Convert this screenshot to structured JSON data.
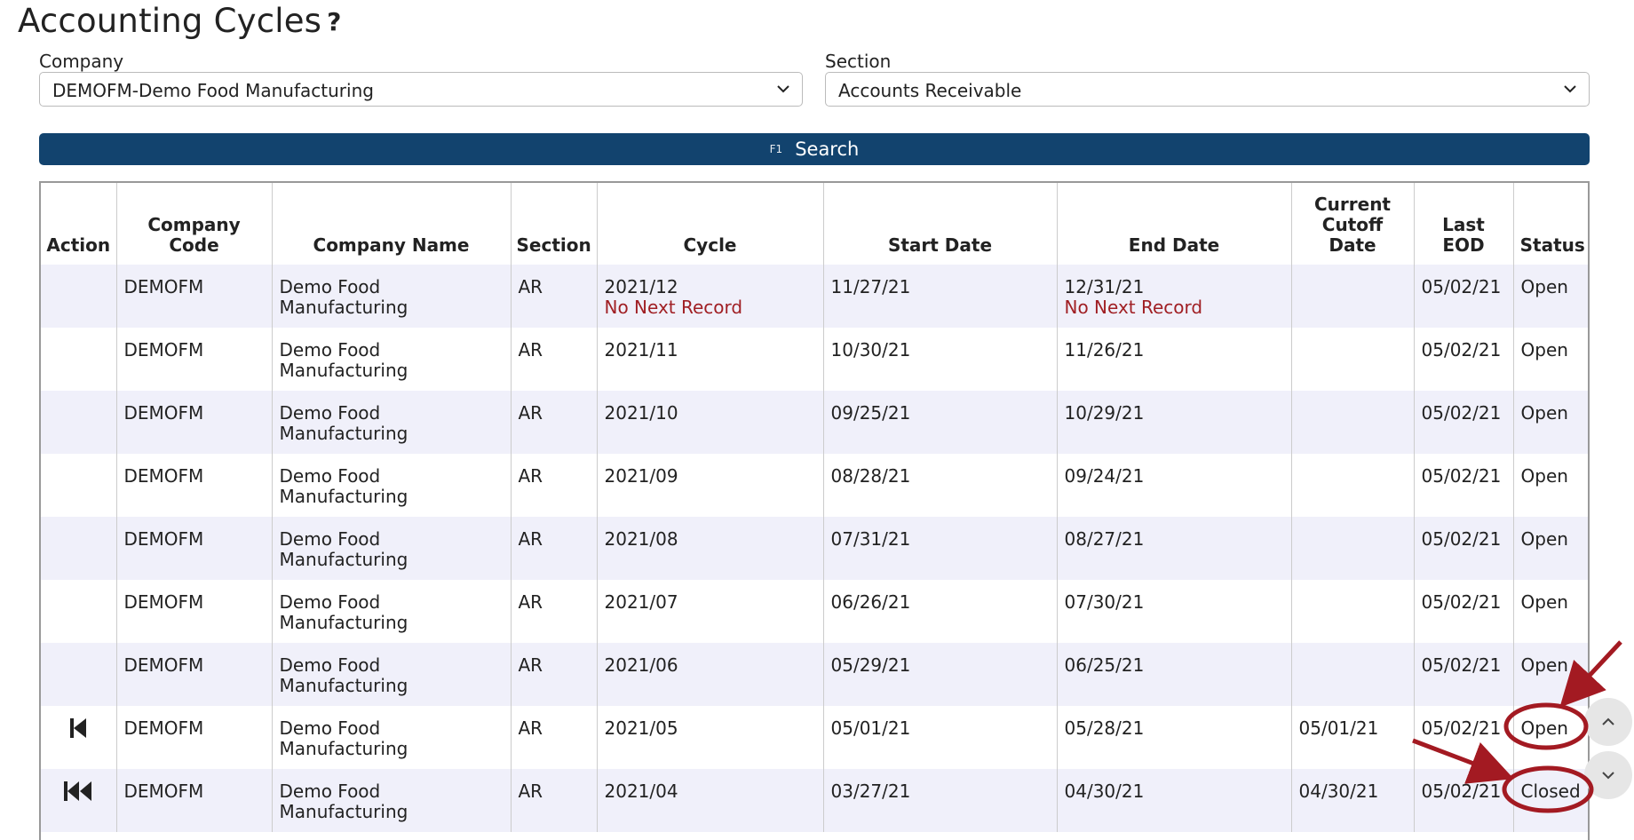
{
  "page": {
    "title": "Accounting Cycles",
    "help_glyph": "?"
  },
  "filters": {
    "company_label": "Company",
    "company_value": "DEMOFM-Demo Food Manufacturing",
    "section_label": "Section",
    "section_value": "Accounts Receivable"
  },
  "search": {
    "key_hint": "F1",
    "label": "Search"
  },
  "table": {
    "headers": [
      "Action",
      "Company Code",
      "Company Name",
      "Section",
      "Cycle",
      "Start Date",
      "End Date",
      "Current Cutoff Date",
      "Last EOD",
      "Status"
    ],
    "rows": [
      {
        "action_icon": "",
        "code": "DEMOFM",
        "name_1": "Demo Food",
        "name_2": "Manufacturing",
        "section": "AR",
        "cycle": "2021/12",
        "cycle_note": "No Next Record",
        "start": "11/27/21",
        "end": "12/31/21",
        "end_note": "No Next Record",
        "cutoff": "",
        "last_eod": "05/02/21",
        "status": "Open"
      },
      {
        "action_icon": "",
        "code": "DEMOFM",
        "name_1": "Demo Food",
        "name_2": "Manufacturing",
        "section": "AR",
        "cycle": "2021/11",
        "cycle_note": "",
        "start": "10/30/21",
        "end": "11/26/21",
        "end_note": "",
        "cutoff": "",
        "last_eod": "05/02/21",
        "status": "Open"
      },
      {
        "action_icon": "",
        "code": "DEMOFM",
        "name_1": "Demo Food",
        "name_2": "Manufacturing",
        "section": "AR",
        "cycle": "2021/10",
        "cycle_note": "",
        "start": "09/25/21",
        "end": "10/29/21",
        "end_note": "",
        "cutoff": "",
        "last_eod": "05/02/21",
        "status": "Open"
      },
      {
        "action_icon": "",
        "code": "DEMOFM",
        "name_1": "Demo Food",
        "name_2": "Manufacturing",
        "section": "AR",
        "cycle": "2021/09",
        "cycle_note": "",
        "start": "08/28/21",
        "end": "09/24/21",
        "end_note": "",
        "cutoff": "",
        "last_eod": "05/02/21",
        "status": "Open"
      },
      {
        "action_icon": "",
        "code": "DEMOFM",
        "name_1": "Demo Food",
        "name_2": "Manufacturing",
        "section": "AR",
        "cycle": "2021/08",
        "cycle_note": "",
        "start": "07/31/21",
        "end": "08/27/21",
        "end_note": "",
        "cutoff": "",
        "last_eod": "05/02/21",
        "status": "Open"
      },
      {
        "action_icon": "",
        "code": "DEMOFM",
        "name_1": "Demo Food",
        "name_2": "Manufacturing",
        "section": "AR",
        "cycle": "2021/07",
        "cycle_note": "",
        "start": "06/26/21",
        "end": "07/30/21",
        "end_note": "",
        "cutoff": "",
        "last_eod": "05/02/21",
        "status": "Open"
      },
      {
        "action_icon": "",
        "code": "DEMOFM",
        "name_1": "Demo Food",
        "name_2": "Manufacturing",
        "section": "AR",
        "cycle": "2021/06",
        "cycle_note": "",
        "start": "05/29/21",
        "end": "06/25/21",
        "end_note": "",
        "cutoff": "",
        "last_eod": "05/02/21",
        "status": "Open"
      },
      {
        "action_icon": "skip-back-icon",
        "code": "DEMOFM",
        "name_1": "Demo Food",
        "name_2": "Manufacturing",
        "section": "AR",
        "cycle": "2021/05",
        "cycle_note": "",
        "start": "05/01/21",
        "end": "05/28/21",
        "end_note": "",
        "cutoff": "05/01/21",
        "last_eod": "05/02/21",
        "status": "Open"
      },
      {
        "action_icon": "rewind-icon",
        "code": "DEMOFM",
        "name_1": "Demo Food",
        "name_2": "Manufacturing",
        "section": "AR",
        "cycle": "2021/04",
        "cycle_note": "",
        "start": "03/27/21",
        "end": "04/30/21",
        "end_note": "",
        "cutoff": "04/30/21",
        "last_eod": "05/02/21",
        "status": "Closed"
      }
    ]
  },
  "colors": {
    "primary": "#12436e",
    "row_alt": "#f0f0fa",
    "note_red": "#a01f24",
    "annotation_red": "#a31a22"
  },
  "icons": {
    "chevron": "chevron-down-icon",
    "scroll_up": "chevron-up-icon",
    "scroll_down": "chevron-down-icon"
  }
}
